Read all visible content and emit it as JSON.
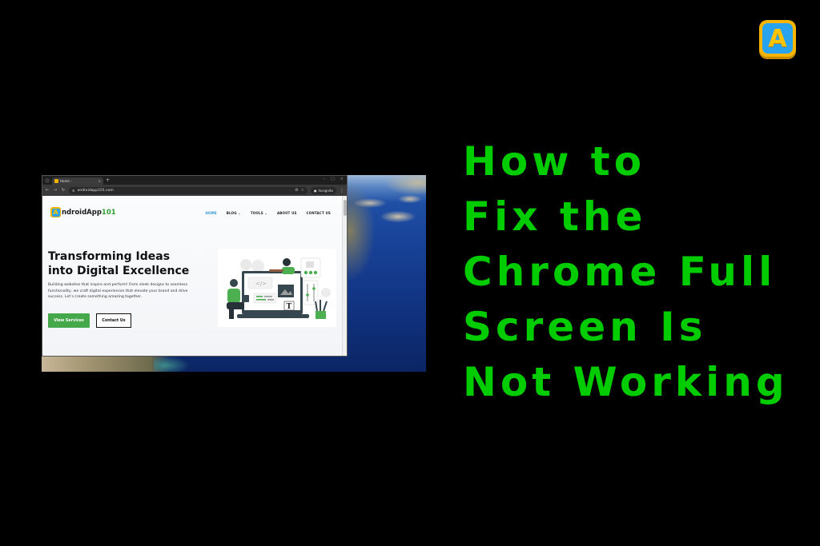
{
  "headline": {
    "lines": [
      "How to",
      "Fix the",
      "Chrome Full",
      "Screen Is",
      "Not Working"
    ],
    "color": "#00cc00"
  },
  "brand_badge": {
    "letter": "A",
    "icon": "android-app-logo-icon"
  },
  "browser": {
    "tab": {
      "title": "Home -",
      "close": "×"
    },
    "new_tab": "+",
    "window_controls": {
      "minimize": "–",
      "maximize": "□",
      "close": "×"
    },
    "toolbar": {
      "back": "←",
      "forward": "→",
      "reload": "↻",
      "url": "androidapp101.com",
      "incognito_label": "Incognito",
      "menu": "⋮"
    }
  },
  "site": {
    "logo": {
      "letter": "A",
      "name": "ndroidApp",
      "suffix": "101"
    },
    "nav": [
      {
        "label": "HOME",
        "active": true
      },
      {
        "label": "BLOG ⌄",
        "active": false
      },
      {
        "label": "TOOLS ⌄",
        "active": false
      },
      {
        "label": "ABOUT US",
        "active": false
      },
      {
        "label": "CONTACT US",
        "active": false
      }
    ],
    "hero": {
      "title_line1": "Transforming Ideas",
      "title_line2": "into Digital Excellence",
      "description": "Building websites that inspire and perform! From sleek designs to seamless functionality, we craft digital experiences that elevate your brand and drive success. Let’s create something amazing together.",
      "primary_button": "View Services",
      "secondary_button": "Contact Us"
    },
    "accent_color": "#45a84a"
  }
}
